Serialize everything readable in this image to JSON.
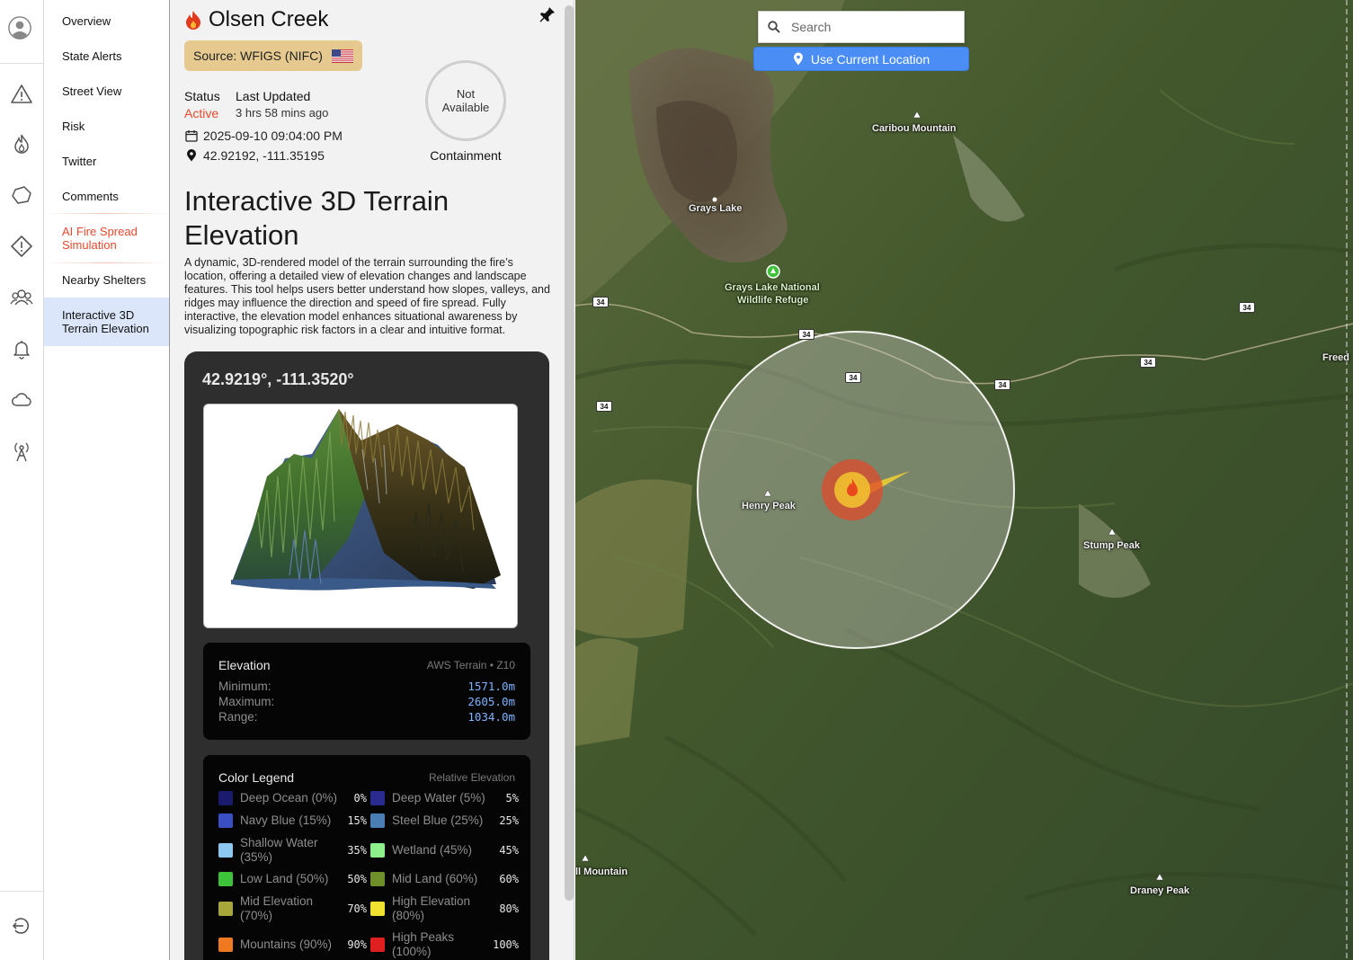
{
  "rail": {
    "icons": [
      "user-avatar-icon",
      "warning-triangle-icon",
      "fire-icon",
      "perimeter-icon",
      "alert-diamond-icon",
      "community-icon",
      "bell-icon",
      "cloud-icon",
      "radio-tower-icon",
      "logout-icon"
    ]
  },
  "nav": {
    "items": [
      {
        "label": "Overview"
      },
      {
        "label": "State Alerts"
      },
      {
        "label": "Street View"
      },
      {
        "label": "Risk"
      },
      {
        "label": "Twitter"
      },
      {
        "label": "Comments"
      },
      {
        "label": "AI Fire Spread Simulation"
      },
      {
        "label": "Nearby Shelters"
      },
      {
        "label": "Interactive 3D Terrain Elevation"
      }
    ],
    "active_index": 8
  },
  "fire": {
    "name": "Olsen Creek",
    "source": "Source: WFIGS (NIFC)",
    "status_label": "Status",
    "status_value": "Active",
    "updated_label": "Last Updated",
    "updated_value": "3 hrs 58 mins ago",
    "date": "2025-09-10 09:04:00 PM",
    "coords": "42.92192, -111.35195",
    "containment_value": "Not Available",
    "containment_label": "Containment"
  },
  "terrain": {
    "title": "Interactive 3D Terrain Elevation",
    "description": "A dynamic, 3D-rendered model of the terrain surrounding the fire’s location, offering a detailed view of elevation changes and landscape features. This tool helps users better understand how slopes, valleys, and ridges may influence the direction and speed of fire spread. Fully interactive, the elevation model enhances situational awareness by visualizing topographic risk factors in a clear and intuitive format.",
    "coord_header": "42.9219°, -111.3520°",
    "elevation": {
      "title": "Elevation",
      "source": "AWS Terrain • Z10",
      "rows": [
        {
          "label": "Minimum:",
          "value": "1571.0m"
        },
        {
          "label": "Maximum:",
          "value": "2605.0m"
        },
        {
          "label": "Range:",
          "value": "1034.0m"
        }
      ]
    },
    "legend": {
      "title": "Color Legend",
      "subtitle": "Relative Elevation",
      "items": [
        {
          "label": "Deep Ocean (0%)",
          "pct": "0%",
          "color": "#1a1a6e"
        },
        {
          "label": "Deep Water (5%)",
          "pct": "5%",
          "color": "#2b2a8f"
        },
        {
          "label": "Navy Blue (15%)",
          "pct": "15%",
          "color": "#3a4fc4"
        },
        {
          "label": "Steel Blue (25%)",
          "pct": "25%",
          "color": "#4a7fb5"
        },
        {
          "label": "Shallow Water (35%)",
          "pct": "35%",
          "color": "#8cc8f0"
        },
        {
          "label": "Wetland (45%)",
          "pct": "45%",
          "color": "#8ef08a"
        },
        {
          "label": "Low Land (50%)",
          "pct": "50%",
          "color": "#3ec43a"
        },
        {
          "label": "Mid Land (60%)",
          "pct": "60%",
          "color": "#6e8f2a"
        },
        {
          "label": "Mid Elevation (70%)",
          "pct": "70%",
          "color": "#a8a83a"
        },
        {
          "label": "High Elevation (80%)",
          "pct": "80%",
          "color": "#f0e030"
        },
        {
          "label": "Mountains (90%)",
          "pct": "90%",
          "color": "#f07820"
        },
        {
          "label": "High Peaks (100%)",
          "pct": "100%",
          "color": "#e02020"
        }
      ]
    }
  },
  "map": {
    "search_placeholder": "Search",
    "use_location_label": "Use Current Location",
    "labels": {
      "caribou": "Caribou Mountain",
      "grays_lake": "Grays Lake",
      "refuge_1": "Grays Lake National",
      "refuge_2": "Wildlife Refuge",
      "henry": "Henry Peak",
      "stump": "Stump Peak",
      "draney": "Draney Peak",
      "mountain_left": "ll Mountain",
      "freedom": "Freed"
    },
    "highway": "34"
  }
}
